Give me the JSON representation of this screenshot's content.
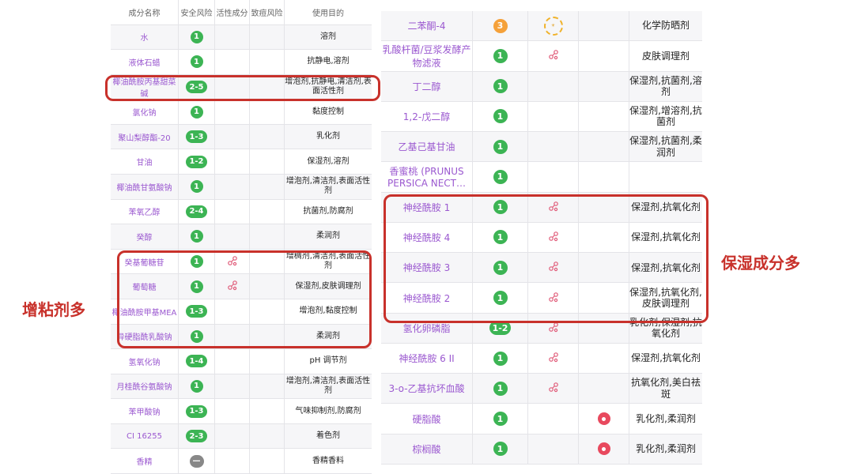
{
  "left_table": {
    "headers": [
      "成分名称",
      "安全风险",
      "活性成分",
      "致痘风险",
      "使用目的"
    ],
    "rows": [
      {
        "name": "水",
        "risk": "1",
        "active": false,
        "use": "溶剂"
      },
      {
        "name": "液体石蜡",
        "risk": "1",
        "active": false,
        "use": "抗静电,溶剂"
      },
      {
        "name": "椰油酰胺丙基甜菜碱",
        "risk": "2-5",
        "active": false,
        "use": "增泡剂,抗静电,清洁剂,表面活性剂"
      },
      {
        "name": "氯化钠",
        "risk": "1",
        "active": false,
        "use": "黏度控制"
      },
      {
        "name": "聚山梨醇酯-20",
        "risk": "1-3",
        "active": false,
        "use": "乳化剂"
      },
      {
        "name": "甘油",
        "risk": "1-2",
        "active": false,
        "use": "保湿剂,溶剂"
      },
      {
        "name": "椰油酰甘氨酸钠",
        "risk": "1",
        "active": false,
        "use": "增泡剂,清洁剂,表面活性剂"
      },
      {
        "name": "苯氧乙醇",
        "risk": "2-4",
        "active": false,
        "use": "抗菌剂,防腐剂"
      },
      {
        "name": "癸醇",
        "risk": "1",
        "active": false,
        "use": "柔润剂"
      },
      {
        "name": "癸基葡糖苷",
        "risk": "1",
        "active": true,
        "use": "增稠剂,清洁剂,表面活性剂"
      },
      {
        "name": "葡萄糖",
        "risk": "1",
        "active": true,
        "use": "保湿剂,皮肤调理剂"
      },
      {
        "name": "椰油酰胺甲基MEA",
        "risk": "1-3",
        "active": false,
        "use": "增泡剂,黏度控制"
      },
      {
        "name": "异硬脂酰乳酸钠",
        "risk": "1",
        "active": false,
        "use": "柔润剂"
      },
      {
        "name": "氢氧化钠",
        "risk": "1-4",
        "active": false,
        "use": "pH 调节剂"
      },
      {
        "name": "月桂酰谷氨酸钠",
        "risk": "1",
        "active": false,
        "use": "增泡剂,清洁剂,表面活性剂"
      },
      {
        "name": "苯甲酸钠",
        "risk": "1-3",
        "active": false,
        "use": "气味抑制剂,防腐剂"
      },
      {
        "name": "CI 16255",
        "risk": "2-3",
        "active": false,
        "use": "着色剂"
      },
      {
        "name": "香精",
        "risk": "—",
        "active": false,
        "use": "香精香料"
      }
    ]
  },
  "right_table": {
    "rows": [
      {
        "name": "二苯酮-4",
        "risk": "3",
        "risk_color": "orange",
        "active_icon": "sunscreen",
        "acne": false,
        "use": "化学防晒剂"
      },
      {
        "name": "乳酸杆菌/豆浆发酵产物滤液",
        "risk": "1",
        "active_icon": "molecule",
        "acne": false,
        "use": "皮肤调理剂"
      },
      {
        "name": "丁二醇",
        "risk": "1",
        "active_icon": "",
        "acne": false,
        "use": "保湿剂,抗菌剂,溶剂"
      },
      {
        "name": "1,2-戊二醇",
        "risk": "1",
        "active_icon": "",
        "acne": false,
        "use": "保湿剂,增溶剂,抗菌剂"
      },
      {
        "name": "乙基己基甘油",
        "risk": "1",
        "active_icon": "",
        "acne": false,
        "use": "保湿剂,抗菌剂,柔润剂"
      },
      {
        "name": "香蜜桃 (PRUNUS PERSICA NECT…",
        "risk": "1",
        "active_icon": "",
        "acne": false,
        "use": ""
      },
      {
        "name": "神经酰胺 1",
        "risk": "1",
        "active_icon": "molecule",
        "acne": false,
        "use": "保湿剂,抗氧化剂"
      },
      {
        "name": "神经酰胺 4",
        "risk": "1",
        "active_icon": "molecule",
        "acne": false,
        "use": "保湿剂,抗氧化剂"
      },
      {
        "name": "神经酰胺 3",
        "risk": "1",
        "active_icon": "molecule",
        "acne": false,
        "use": "保湿剂,抗氧化剂"
      },
      {
        "name": "神经酰胺 2",
        "risk": "1",
        "active_icon": "molecule",
        "acne": false,
        "use": "保湿剂,抗氧化剂,皮肤调理剂"
      },
      {
        "name": "氢化卵磷脂",
        "risk": "1-2",
        "active_icon": "molecule",
        "acne": false,
        "use": "乳化剂,保湿剂,抗氧化剂"
      },
      {
        "name": "神经酰胺 6 II",
        "risk": "1",
        "active_icon": "molecule",
        "acne": false,
        "use": "保湿剂,抗氧化剂"
      },
      {
        "name": "3-o-乙基抗坏血酸",
        "risk": "1",
        "active_icon": "molecule",
        "acne": false,
        "use": "抗氧化剂,美白祛斑"
      },
      {
        "name": "硬脂酸",
        "risk": "1",
        "active_icon": "",
        "acne": true,
        "use": "乳化剂,柔润剂"
      },
      {
        "name": "棕榈酸",
        "risk": "1",
        "active_icon": "",
        "acne": true,
        "use": "乳化剂,柔润剂"
      }
    ]
  },
  "annotations": {
    "left": "增粘剂多",
    "right": "保湿成分多"
  },
  "colors": {
    "accent": "#c8312b",
    "safe": "#3cb454",
    "warn": "#f5a13a",
    "name": "#9b59d0"
  }
}
